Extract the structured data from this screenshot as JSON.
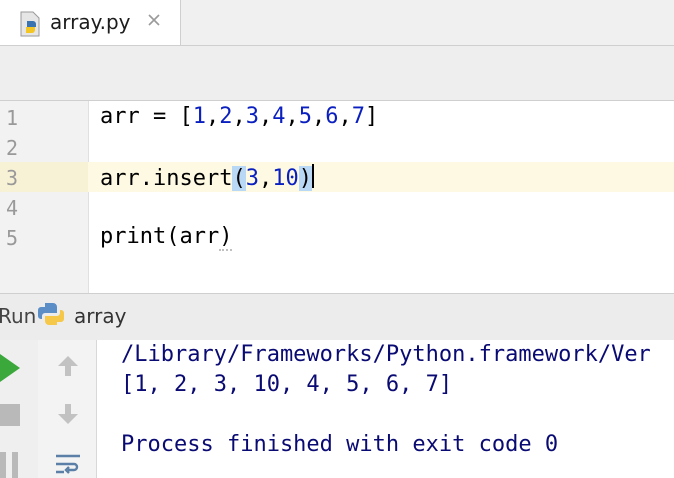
{
  "tab": {
    "filename": "array.py"
  },
  "editor": {
    "line_numbers": [
      "1",
      "2",
      "3",
      "4",
      "5"
    ],
    "lines": [
      {
        "prefix": "arr = [",
        "nums": [
          "1",
          "2",
          "3",
          "4",
          "5",
          "6",
          "7"
        ],
        "suffix": "]"
      },
      {
        "text": ""
      },
      {
        "prefix": "arr.insert",
        "open": "(",
        "a": "3",
        "comma": ",",
        "b": "10",
        "close": ")"
      },
      {
        "text": ""
      },
      {
        "prefix": "print(arr",
        "close": ")"
      }
    ]
  },
  "run_panel": {
    "label": "Run",
    "config_name": "array",
    "output": [
      "/Library/Frameworks/Python.framework/Ver",
      "[1, 2, 3, 10, 4, 5, 6, 7]",
      "",
      "Process finished with exit code 0"
    ]
  },
  "colors": {
    "number": "#0a1fbf",
    "output_text": "#0a0a73",
    "run_green": "#3aa83a",
    "caret_line": "#fdf9e3"
  },
  "icons": [
    "python-file-icon",
    "close-icon",
    "python-icon",
    "run-icon",
    "stop-icon",
    "pause-icon",
    "up-arrow-icon",
    "down-arrow-icon",
    "soft-wrap-icon"
  ]
}
